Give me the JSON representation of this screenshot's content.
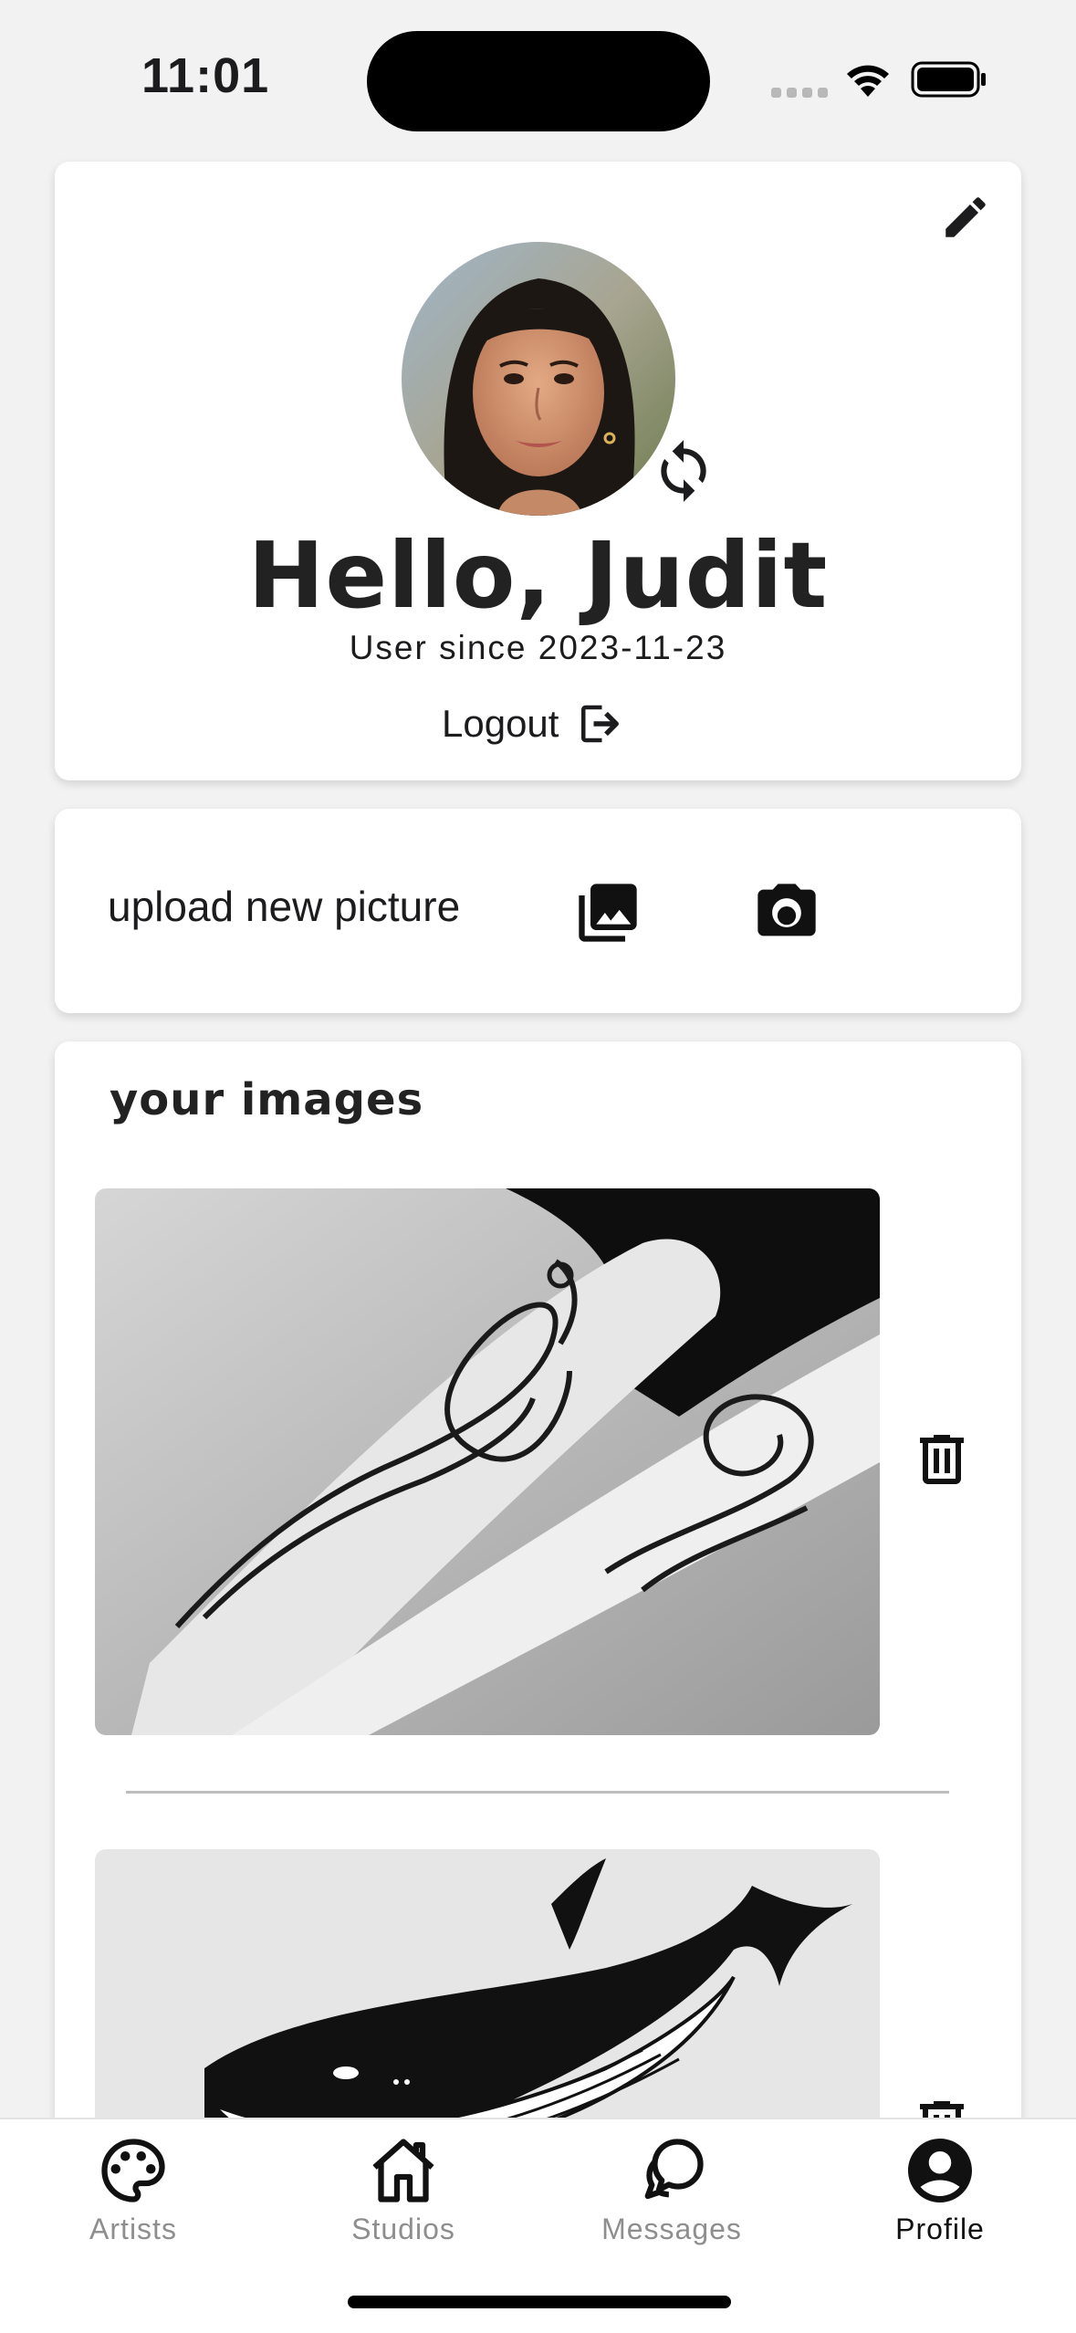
{
  "status_bar": {
    "time": "11:01"
  },
  "profile": {
    "greeting": "Hello, Judit",
    "since": "User since 2023-11-23",
    "logout_label": "Logout"
  },
  "upload": {
    "label": "upload new picture"
  },
  "images": {
    "title": "your images"
  },
  "tabs": [
    {
      "label": "Artists",
      "icon": "palette-icon"
    },
    {
      "label": "Studios",
      "icon": "home-icon"
    },
    {
      "label": "Messages",
      "icon": "chat-bubbles-icon"
    },
    {
      "label": "Profile",
      "icon": "account-circle-icon"
    }
  ],
  "active_tab": "Profile",
  "colors": {
    "accent": "#1c1c1e",
    "inactive_tab": "#8e8e8e",
    "background": "#f2f2f2"
  }
}
